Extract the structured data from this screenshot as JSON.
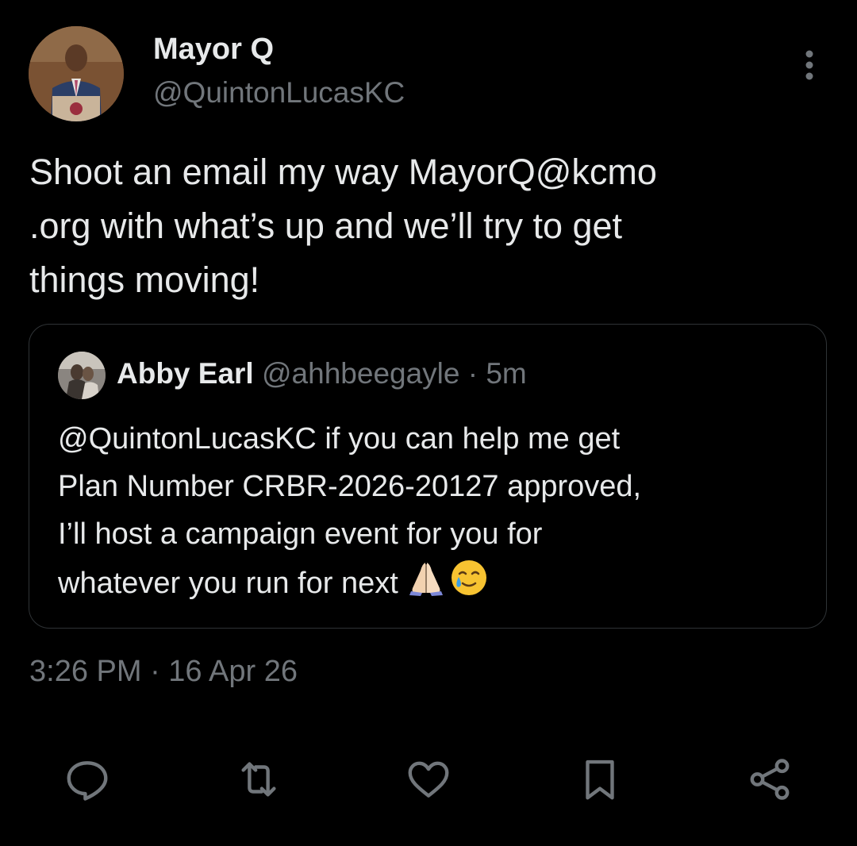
{
  "author": {
    "display_name": "Mayor Q",
    "handle": "@QuintonLucasKC"
  },
  "tweet": {
    "text": "Shoot an email my way MayorQ@kcmo\n.org with what’s up and we’ll try to get\nthings moving!",
    "timestamp": "3:26 PM · 16 Apr 26"
  },
  "quoted_tweet": {
    "display_name": "Abby Earl",
    "meta": " @ahhbeegayle · 5m",
    "text": "@QuintonLucasKC if you can help me get\nPlan Number CRBR-2026-20127 approved,\nI’ll host a campaign event for you for\nwhatever you run for next",
    "emojis": [
      "🙏",
      "🥲"
    ]
  },
  "actions": {
    "reply_icon": "reply-icon",
    "retweet_icon": "retweet-icon",
    "like_icon": "heart-icon",
    "bookmark_icon": "bookmark-icon",
    "share_icon": "share-icon"
  },
  "colors": {
    "background": "#000000",
    "primary_text": "#e7e9ea",
    "secondary_text": "#71767b",
    "border": "#2f3336"
  }
}
